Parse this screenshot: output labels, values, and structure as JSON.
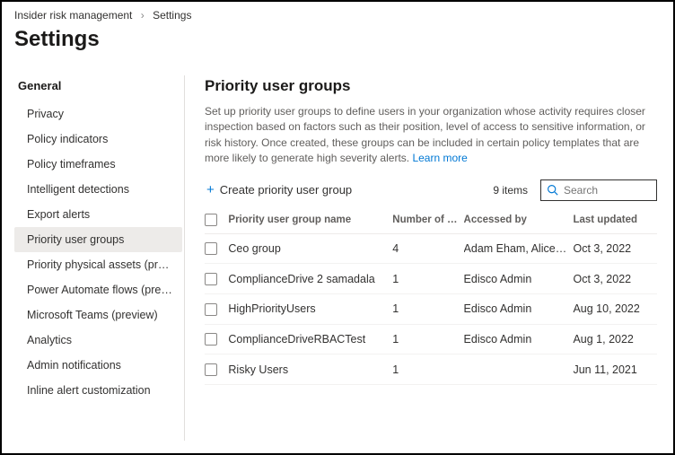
{
  "breadcrumb": {
    "root": "Insider risk management",
    "current": "Settings"
  },
  "page_title": "Settings",
  "sidebar": {
    "header": "General",
    "items": [
      {
        "label": "Privacy"
      },
      {
        "label": "Policy indicators"
      },
      {
        "label": "Policy timeframes"
      },
      {
        "label": "Intelligent detections"
      },
      {
        "label": "Export alerts"
      },
      {
        "label": "Priority user groups",
        "selected": true
      },
      {
        "label": "Priority physical assets (preview)"
      },
      {
        "label": "Power Automate flows (preview)"
      },
      {
        "label": "Microsoft Teams (preview)"
      },
      {
        "label": "Analytics"
      },
      {
        "label": "Admin notifications"
      },
      {
        "label": "Inline alert customization"
      }
    ]
  },
  "main": {
    "title": "Priority user groups",
    "description": "Set up priority user groups to define users in your organization whose activity requires closer inspection based on factors such as their position, level of access to sensitive information, or risk history. Once created, these groups can be included in certain policy templates that are more likely to generate high severity alerts.",
    "learn_more": "Learn more",
    "create_label": "Create priority user group",
    "item_count": "9 items",
    "search_placeholder": "Search",
    "columns": {
      "name": "Priority user group name",
      "members": "Number of memb...",
      "accessed": "Accessed by",
      "updated": "Last updated"
    },
    "rows": [
      {
        "name": "Ceo group",
        "members": "4",
        "accessed": "Adam Eham, Alice Doe",
        "updated": "Oct 3, 2022"
      },
      {
        "name": "ComplianceDrive 2 samadala",
        "members": "1",
        "accessed": "Edisco Admin",
        "updated": "Oct 3, 2022"
      },
      {
        "name": "HighPriorityUsers",
        "members": "1",
        "accessed": "Edisco Admin",
        "updated": "Aug 10, 2022"
      },
      {
        "name": "ComplianceDriveRBACTest",
        "members": "1",
        "accessed": "Edisco Admin",
        "updated": "Aug 1, 2022"
      },
      {
        "name": "Risky Users",
        "members": "1",
        "accessed": "",
        "updated": "Jun 11, 2021"
      }
    ]
  }
}
